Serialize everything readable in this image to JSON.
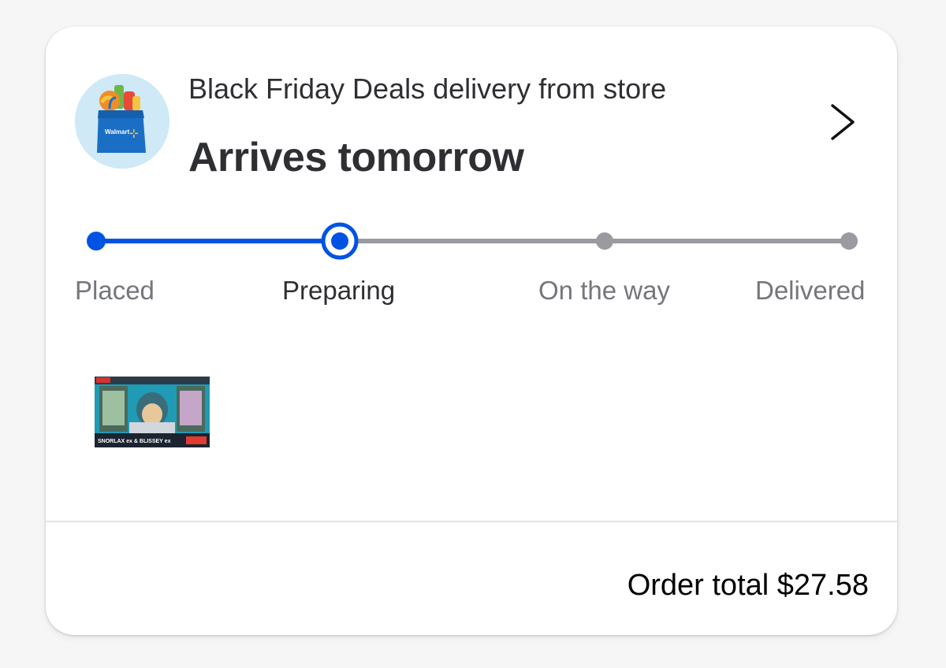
{
  "order_card": {
    "subtitle": "Black Friday Deals delivery from store",
    "headline": "Arrives tomorrow",
    "store_logo_text": "Walmart",
    "tracker": {
      "steps": [
        {
          "label": "Placed",
          "state": "complete"
        },
        {
          "label": "Preparing",
          "state": "current"
        },
        {
          "label": "On the way",
          "state": "upcoming"
        },
        {
          "label": "Delivered",
          "state": "upcoming"
        }
      ]
    },
    "product": {
      "box_text": "SNORLAX ex & BLISSEY ex"
    },
    "total_text": "Order total $27.58"
  },
  "colors": {
    "progress_active": "#0053e2",
    "progress_inactive": "#9a9ba0",
    "avatar_bg": "#cfe9f7",
    "bag_blue": "#1a6fc4"
  },
  "icons": {
    "chevron": "chevron-right-icon",
    "store": "walmart-bag-icon"
  }
}
